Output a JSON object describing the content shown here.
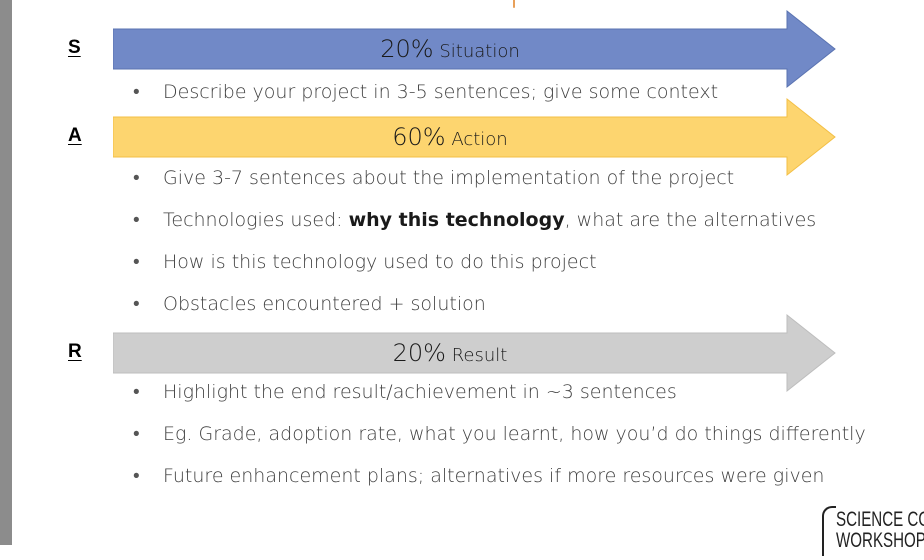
{
  "colors": {
    "situation": "#7189c7",
    "action": "#fdd56f",
    "result": "#cecece",
    "accent": "#e8a05a"
  },
  "sections": [
    {
      "letter": "S",
      "percent": "20%",
      "title_first": "S",
      "title_rest": "ituation",
      "bullets": [
        "Describe your project in 3-5 sentences; give some context"
      ]
    },
    {
      "letter": "A",
      "percent": "60%",
      "title_first": "A",
      "title_rest": "ction",
      "bullets": [
        "Give 3-7 sentences about the implementation of the project",
        "How is this technology used to do this project",
        "Obstacles encountered + solution"
      ],
      "tech_bullet": {
        "prefix": "Technologies used: ",
        "bold": "why this technology",
        "suffix": ", what are the alternatives"
      }
    },
    {
      "letter": "R",
      "percent": "20%",
      "title_first": "R",
      "title_rest": "esult",
      "bullets": [
        "Highlight the end result/achievement in ~3 sentences",
        "Eg. Grade, adoption rate, what you learnt, how you’d do things differently",
        "Future enhancement plans; alternatives if more resources were given"
      ]
    }
  ],
  "logo": {
    "line1": "SCIENCE CO-OP",
    "line2": "WORKSHOP"
  }
}
